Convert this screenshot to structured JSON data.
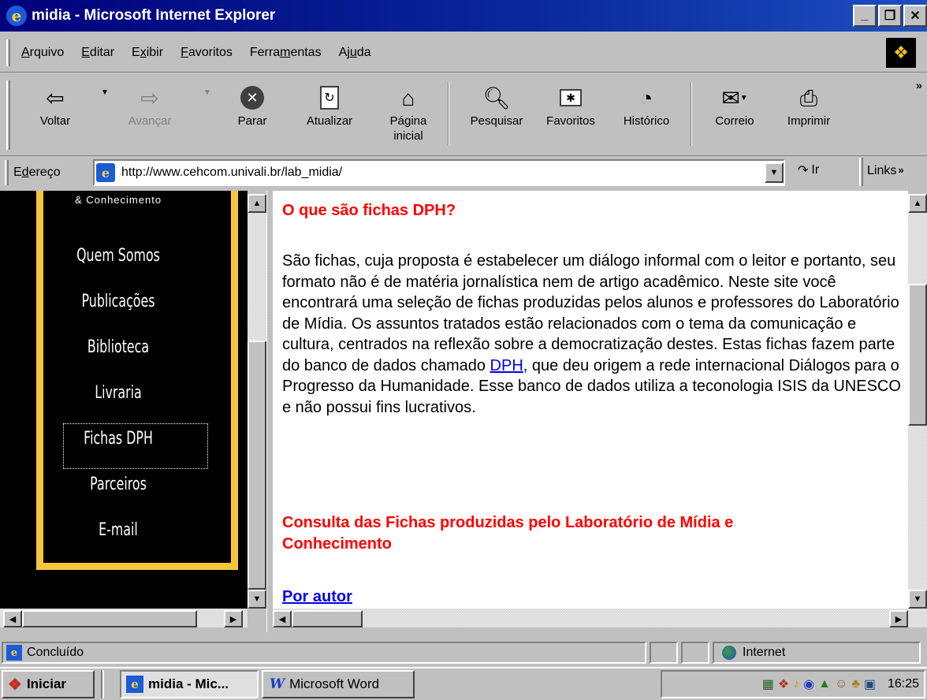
{
  "window": {
    "title": "midia - Microsoft Internet Explorer"
  },
  "menu": [
    {
      "pre": "",
      "acc": "A",
      "post": "rquivo"
    },
    {
      "pre": "",
      "acc": "E",
      "post": "ditar"
    },
    {
      "pre": "E",
      "acc": "x",
      "post": "ibir"
    },
    {
      "pre": "",
      "acc": "F",
      "post": "avoritos"
    },
    {
      "pre": "Ferra",
      "acc": "m",
      "post": "entas"
    },
    {
      "pre": "Aj",
      "acc": "u",
      "post": "da"
    }
  ],
  "toolbar": {
    "back": "Voltar",
    "forward": "Avançar",
    "stop": "Parar",
    "refresh": "Atualizar",
    "home_1": "Página",
    "home_2": "inicial",
    "search": "Pesquisar",
    "favorites": "Favoritos",
    "history": "Histórico",
    "mail": "Correio",
    "print": "Imprimir",
    "more": "»"
  },
  "address": {
    "label_acc": "d",
    "label_pre": "E",
    "label_post": "ereço",
    "url": "http://www.cehcom.univali.br/lab_midia/",
    "go": "Ir",
    "links": "Links",
    "links_more": "»"
  },
  "nav": {
    "tagline": "& Conhecimento",
    "items": [
      "Quem Somos",
      "Publicações",
      "Biblioteca",
      "Livraria",
      "Fichas DPH",
      "Parceiros",
      "E-mail"
    ]
  },
  "content": {
    "heading1": "O que são fichas DPH?",
    "paragraph_before": "São fichas, cuja proposta é  estabelecer um diálogo informal com o leitor e portanto, seu formato não é de matéria jornalística nem de artigo acadêmico. Neste site você encontrará uma seleção de fichas produzidas pelos alunos e professores do Laboratório de Mídia. Os assuntos tratados estão relacionados com o tema da comunicação e cultura, centrados na reflexão sobre a democratização destes. Estas fichas fazem parte do banco de dados chamado ",
    "link_dph": "DPH",
    "paragraph_after": ", que deu origem a rede internacional Diálogos para o Progresso da Humanidade. Esse banco de dados utiliza a teconologia ISIS da UNESCO e não possui fins lucrativos.",
    "heading2": "Consulta das Fichas produzidas pelo Laboratório de Mídia e Conhecimento",
    "link_author": "Por autor"
  },
  "statusbar": {
    "text": "Concluído",
    "zone": "Internet"
  },
  "taskbar": {
    "start": "Iniciar",
    "task1": "midia - Mic...",
    "task2": "Microsoft Word",
    "clock": "16:25"
  },
  "colors": {
    "title_blue": "#00007b",
    "heading_red": "#ff0000",
    "link_blue": "#0000ee",
    "nav_border": "#f5c63c"
  }
}
